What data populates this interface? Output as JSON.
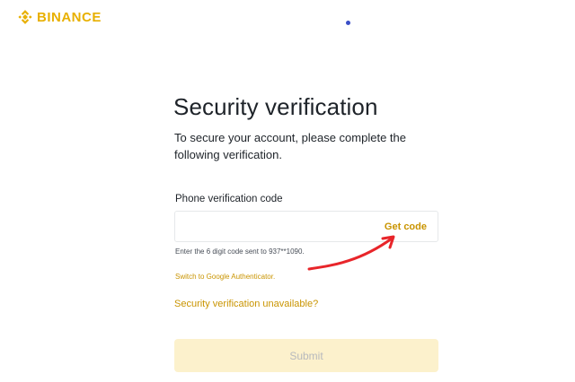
{
  "brand": {
    "name": "BINANCE",
    "color": "#e8b000",
    "logo_icon": "binance-diamond-icon"
  },
  "verification": {
    "title": "Security verification",
    "subtitle": "To secure your account, please complete the following verification.",
    "phone_label": "Phone verification code",
    "code_value": "",
    "get_code_label": "Get code",
    "hint": "Enter the 6 digit code sent to 937**1090.",
    "switch_label": "Switch to Google Authenticator.",
    "unavailable_label": "Security verification unavailable?",
    "submit_label": "Submit"
  },
  "colors": {
    "accent": "#c99400",
    "text": "#1e2329",
    "submit_bg": "#fcf1cc",
    "annotation_arrow": "#e8252a"
  },
  "annotation": {
    "arrow_icon": "red-arrow-annotation"
  }
}
